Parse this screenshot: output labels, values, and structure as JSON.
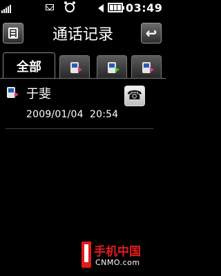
{
  "status_bar": {
    "signal_bars": 4,
    "time": "03:49",
    "icons": [
      "signal-icon",
      "message-icon",
      "alarm-icon",
      "speaker-icon",
      "battery-icon"
    ]
  },
  "header": {
    "title": "通话记录",
    "menu_icon": "menu-icon",
    "back_icon": "back-icon"
  },
  "tabs": [
    {
      "label": "全部",
      "icon": null,
      "active": true
    },
    {
      "label": null,
      "icon": "received-call-icon",
      "active": false
    },
    {
      "label": null,
      "icon": "dialed-call-icon",
      "active": false
    },
    {
      "label": null,
      "icon": "missed-call-icon",
      "active": false
    }
  ],
  "call_log": [
    {
      "name": "于斐",
      "datetime": "2009/01/04  20:54",
      "type_icon": "incoming-call-icon",
      "action_icon": "call-icon"
    }
  ],
  "watermark": {
    "title": "手机中国",
    "site": "CNMO.com"
  },
  "colors": {
    "background": "#000000",
    "accent_pink": "#e0388a",
    "accent_green": "#37c24c",
    "watermark_red": "#e31b1b"
  }
}
